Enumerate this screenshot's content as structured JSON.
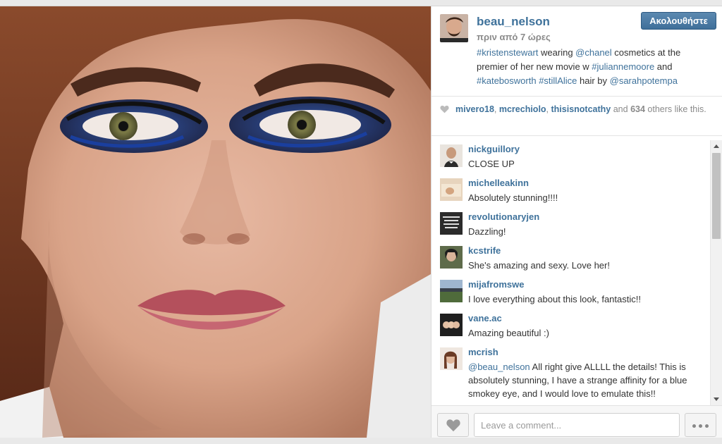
{
  "post": {
    "username": "beau_nelson",
    "time_ago": "πριν από 7 ώρες",
    "follow_label": "Ακολουθήστε",
    "caption": {
      "t1": "#kristenstewart",
      "t2": " wearing ",
      "t3": "@chanel",
      "t4": " cosmetics at the premier of her new movie w ",
      "t5": "#juliannemoore",
      "t6": " and ",
      "t7": "#katebosworth",
      "t8": " ",
      "t9": "#stillAlice",
      "t10": " hair by ",
      "t11": "@sarahpotempa"
    }
  },
  "likes": {
    "liker1": "mivero18",
    "sep1": ", ",
    "liker2": "mcrechiolo",
    "sep2": ", ",
    "liker3": "thisisnotcathy",
    "and_text": " and ",
    "count": "634",
    "tail": " others like this."
  },
  "comments": [
    {
      "user": "nickguillory",
      "text": "CLOSE UP"
    },
    {
      "user": "michelleakinn",
      "text": "Absolutely stunning!!!!"
    },
    {
      "user": "revolutionaryjen",
      "text": "Dazzling!"
    },
    {
      "user": "kcstrife",
      "text": "She's amazing and sexy. Love her!"
    },
    {
      "user": "mijafromswe",
      "text": "I love everything about this look, fantastic!!"
    },
    {
      "user": "vane.ac",
      "text": "Amazing beautiful :)"
    },
    {
      "user": "mcrish",
      "mention": "@beau_nelson",
      "text": " All right give ALLLL the details! This is absolutely stunning, I have a strange affinity for a blue smokey eye, and I would love to emulate this!!"
    }
  ],
  "footer": {
    "comment_placeholder": "Leave a comment..."
  },
  "colors": {
    "link": "#3f729b",
    "follow_button": "#4a7aa5",
    "text": "#333333",
    "muted": "#8a8a8a"
  }
}
